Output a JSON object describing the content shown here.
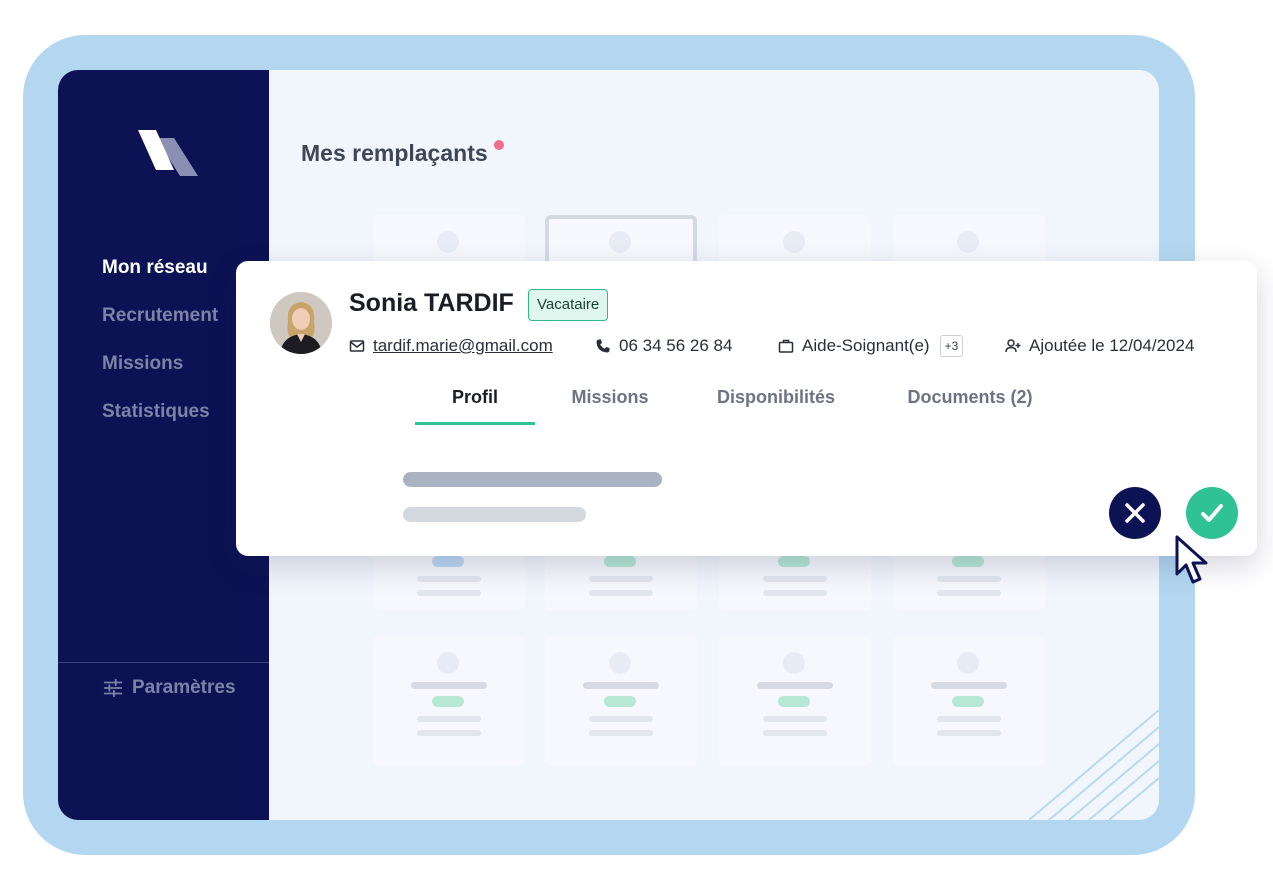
{
  "sidebar": {
    "items": [
      {
        "label": "Mon réseau",
        "active": true
      },
      {
        "label": "Recrutement",
        "active": false
      },
      {
        "label": "Missions",
        "active": false
      },
      {
        "label": "Statistiques",
        "active": false
      }
    ],
    "settings_label": "Paramètres"
  },
  "main": {
    "title": "Mes remplaçants"
  },
  "candidate": {
    "name": "Sonia TARDIF",
    "status": "Vacataire",
    "email": "tardif.marie@gmail.com",
    "phone": "06 34 56 26 84",
    "role": "Aide-Soignant(e)",
    "role_extra": "+3",
    "added": "Ajoutée le 12/04/2024"
  },
  "tabs": [
    {
      "label": "Profil",
      "active": true
    },
    {
      "label": "Missions",
      "active": false
    },
    {
      "label": "Disponibilités",
      "active": false
    },
    {
      "label": "Documents (2)",
      "active": false
    }
  ],
  "colors": {
    "sidebar": "#0c1254",
    "accent": "#2fc294",
    "frame": "#b3d7f1",
    "notification": "#f06c8c"
  }
}
